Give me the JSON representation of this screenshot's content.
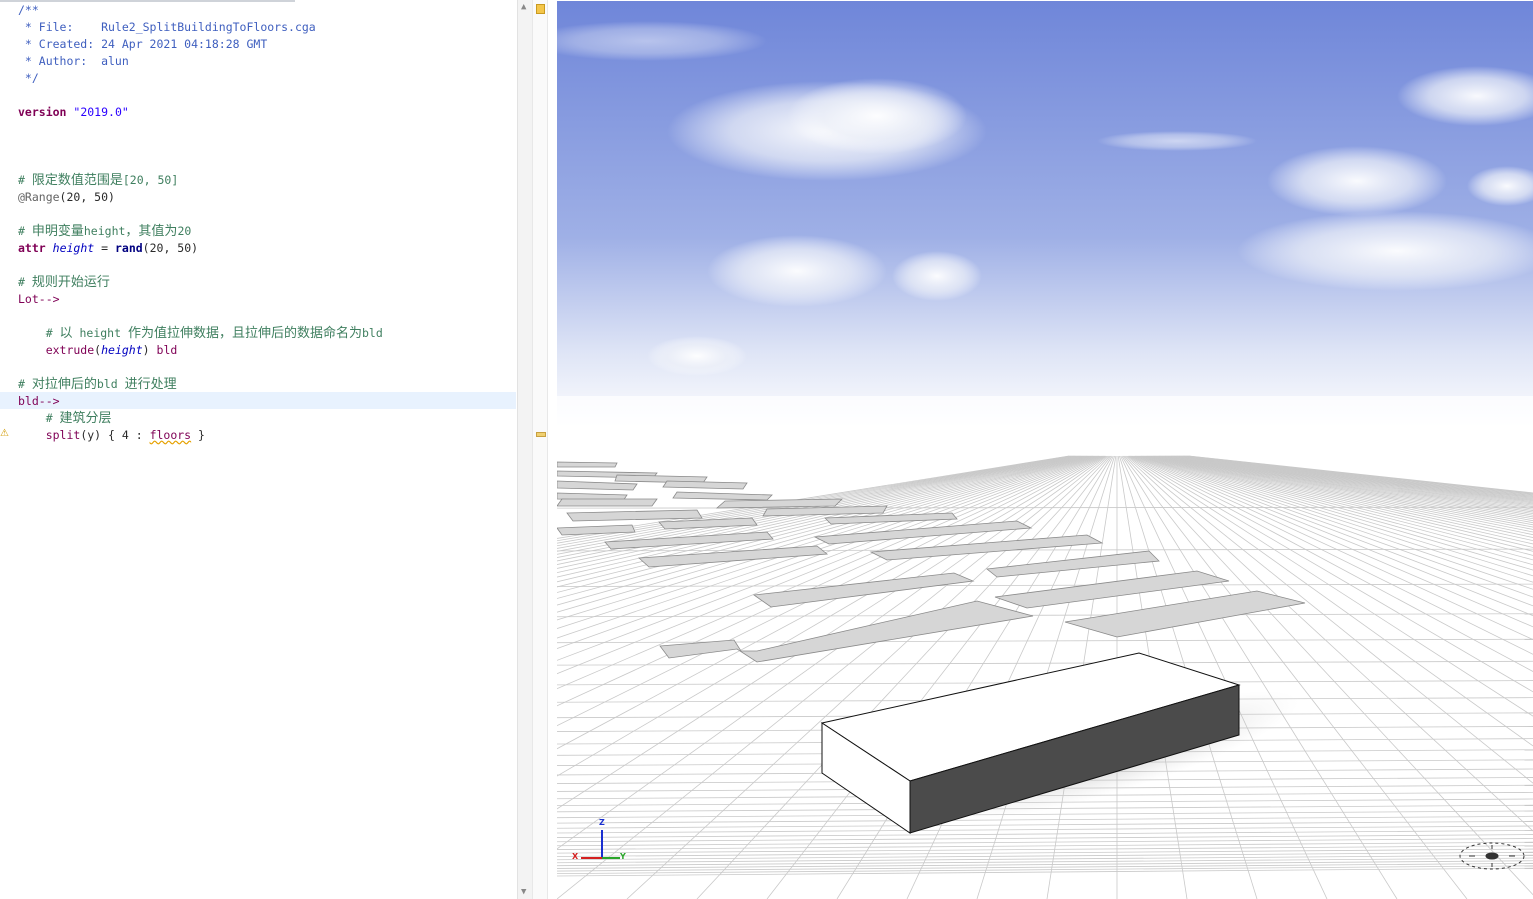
{
  "editor": {
    "lines": [
      {
        "parts": [
          {
            "c": "cmd",
            "t": "/**"
          }
        ]
      },
      {
        "parts": [
          {
            "c": "cmd",
            "t": " * File:    Rule2_SplitBuildingToFloors.cga"
          }
        ]
      },
      {
        "parts": [
          {
            "c": "cmd",
            "t": " * Created: 24 Apr 2021 04:18:28 GMT"
          }
        ]
      },
      {
        "parts": [
          {
            "c": "cmd",
            "t": " * Author:  alun"
          }
        ]
      },
      {
        "parts": [
          {
            "c": "cmd",
            "t": " */"
          }
        ]
      },
      {
        "parts": []
      },
      {
        "parts": [
          {
            "c": "kw",
            "t": "version"
          },
          {
            "c": "txt",
            "t": " "
          },
          {
            "c": "str",
            "t": "\"2019.0\""
          }
        ]
      },
      {
        "parts": []
      },
      {
        "parts": []
      },
      {
        "parts": []
      },
      {
        "parts": [
          {
            "c": "cm",
            "t": "# "
          },
          {
            "c": "cm cjk",
            "t": "限定数值范围是"
          },
          {
            "c": "cm",
            "t": "[20, 50]"
          }
        ]
      },
      {
        "parts": [
          {
            "c": "anno",
            "t": "@Range"
          },
          {
            "c": "txt",
            "t": "(20, 50)"
          }
        ]
      },
      {
        "parts": []
      },
      {
        "parts": [
          {
            "c": "cm",
            "t": "# "
          },
          {
            "c": "cm cjk",
            "t": "申明变量"
          },
          {
            "c": "cm",
            "t": "height"
          },
          {
            "c": "cm cjk",
            "t": "，其值为"
          },
          {
            "c": "cm",
            "t": "20"
          }
        ]
      },
      {
        "parts": [
          {
            "c": "kw",
            "t": "attr"
          },
          {
            "c": "txt",
            "t": " "
          },
          {
            "c": "var",
            "t": "height"
          },
          {
            "c": "txt",
            "t": " = "
          },
          {
            "c": "fn",
            "t": "rand"
          },
          {
            "c": "txt",
            "t": "(20, 50)"
          }
        ]
      },
      {
        "parts": []
      },
      {
        "parts": [
          {
            "c": "cm",
            "t": "# "
          },
          {
            "c": "cm cjk",
            "t": "规则开始运行"
          }
        ]
      },
      {
        "parts": [
          {
            "c": "rule",
            "t": "Lot-->"
          }
        ]
      },
      {
        "parts": []
      },
      {
        "parts": [
          {
            "c": "cm",
            "t": "    # "
          },
          {
            "c": "cm cjk",
            "t": "以"
          },
          {
            "c": "cm",
            "t": " height "
          },
          {
            "c": "cm cjk",
            "t": "作为值拉伸数据，且拉伸后的数据命名为"
          },
          {
            "c": "cm",
            "t": "bld"
          }
        ]
      },
      {
        "parts": [
          {
            "c": "rule",
            "t": "    extrude"
          },
          {
            "c": "txt",
            "t": "("
          },
          {
            "c": "var",
            "t": "height"
          },
          {
            "c": "txt",
            "t": ") "
          },
          {
            "c": "rule",
            "t": "bld"
          }
        ]
      },
      {
        "parts": []
      },
      {
        "parts": [
          {
            "c": "cm",
            "t": "# "
          },
          {
            "c": "cm cjk",
            "t": "对拉伸后的"
          },
          {
            "c": "cm",
            "t": "bld "
          },
          {
            "c": "cm cjk",
            "t": "进行处理"
          }
        ]
      },
      {
        "parts": [
          {
            "c": "rule",
            "t": "bld-->"
          }
        ]
      },
      {
        "parts": [
          {
            "c": "cm",
            "t": "    # "
          },
          {
            "c": "cm cjk",
            "t": "建筑分层"
          }
        ]
      },
      {
        "parts": [
          {
            "c": "rule",
            "t": "    split"
          },
          {
            "c": "txt",
            "t": "(y) { 4 : "
          },
          {
            "c": "rule squig",
            "t": "floors"
          },
          {
            "c": "txt",
            "t": " }"
          }
        ]
      }
    ],
    "warning_icon": "warning-icon",
    "scroll_up": "▲",
    "scroll_down": "▼"
  },
  "viewport": {
    "axis_labels": {
      "z": "Z",
      "x": "X",
      "y": "Y"
    },
    "colors": {
      "sky_top": "#6f86d9",
      "sky_bottom": "#ffffff",
      "ground": "#ffffff",
      "grid": "#c9c9c9",
      "lot_fill": "#d6d6d6",
      "building_top": "#ffffff",
      "building_side": "#4b4b4b",
      "axis_x": "#d42020",
      "axis_y": "#2aa52a",
      "axis_z": "#1a2fd0"
    },
    "compass_icon": "compass-icon"
  }
}
